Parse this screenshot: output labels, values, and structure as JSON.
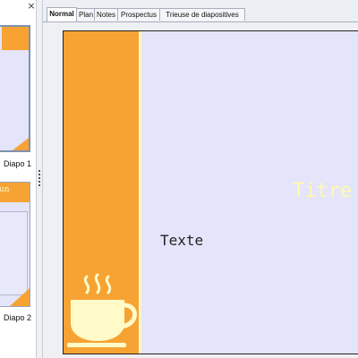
{
  "slide_pane": {
    "close_glyph": "×",
    "thumbnails": [
      {
        "label": "Diapo 1"
      },
      {
        "label": "Diapo 2",
        "partial_text": "un"
      }
    ]
  },
  "tabs": [
    {
      "label": "Normal",
      "active": true
    },
    {
      "label": "Plan",
      "active": false
    },
    {
      "label": "Notes",
      "active": false
    },
    {
      "label": "Prospectus",
      "active": false
    },
    {
      "label": "Trieuse de diapositives",
      "active": false
    }
  ],
  "slide": {
    "title": "Titre",
    "body_text": "Texte",
    "decoration_icon": "coffee-cup-icon"
  },
  "colors": {
    "accent_orange": "#f6a334",
    "slide_background": "#e4e4fa",
    "title_color": "#fffab0",
    "cup_color": "#fffac8"
  }
}
